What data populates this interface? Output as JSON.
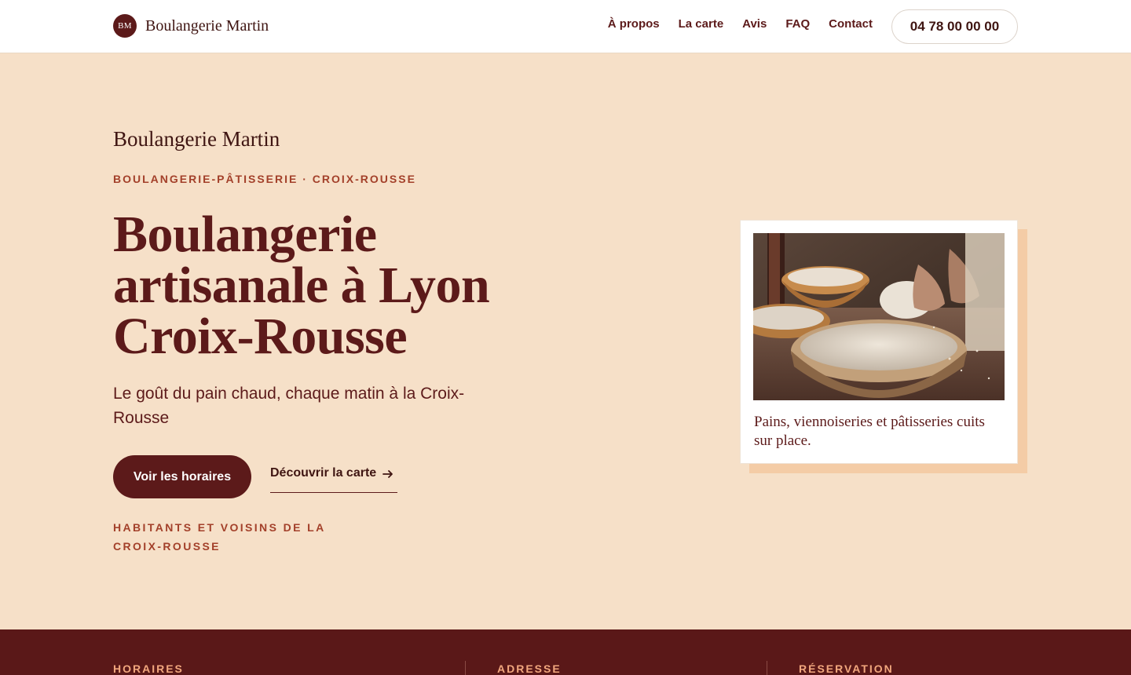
{
  "header": {
    "logo_initials": "BM",
    "brand_name": "Boulangerie Martin",
    "nav": [
      "À propos",
      "La carte",
      "Avis",
      "FAQ",
      "Contact"
    ],
    "phone": "04 78 00 00 00"
  },
  "hero": {
    "brand": "Boulangerie Martin",
    "eyebrow": "BOULANGERIE-PÂTISSERIE · CROIX-ROUSSE",
    "title": "Boulangerie artisanale à Lyon Croix-Rousse",
    "subtitle": "Le goût du pain chaud, chaque matin à la Croix-Rousse",
    "cta_primary": "Voir les horaires",
    "cta_secondary": "Découvrir la carte",
    "tagline": "HABITANTS ET VOISINS DE LA CROIX-ROUSSE"
  },
  "card": {
    "image_icon": "bread-dough-photo",
    "caption": "Pains, viennoiseries et pâtisseries cuits sur place."
  },
  "info": {
    "hours_label": "HORAIRES",
    "address_label": "ADRESSE",
    "booking_label": "RÉSERVATION"
  },
  "colors": {
    "primary": "#5c1a1a",
    "accent": "#a3402a",
    "background": "#f6e0c8",
    "band": "#5a1818",
    "band_label": "#f2a77e"
  }
}
